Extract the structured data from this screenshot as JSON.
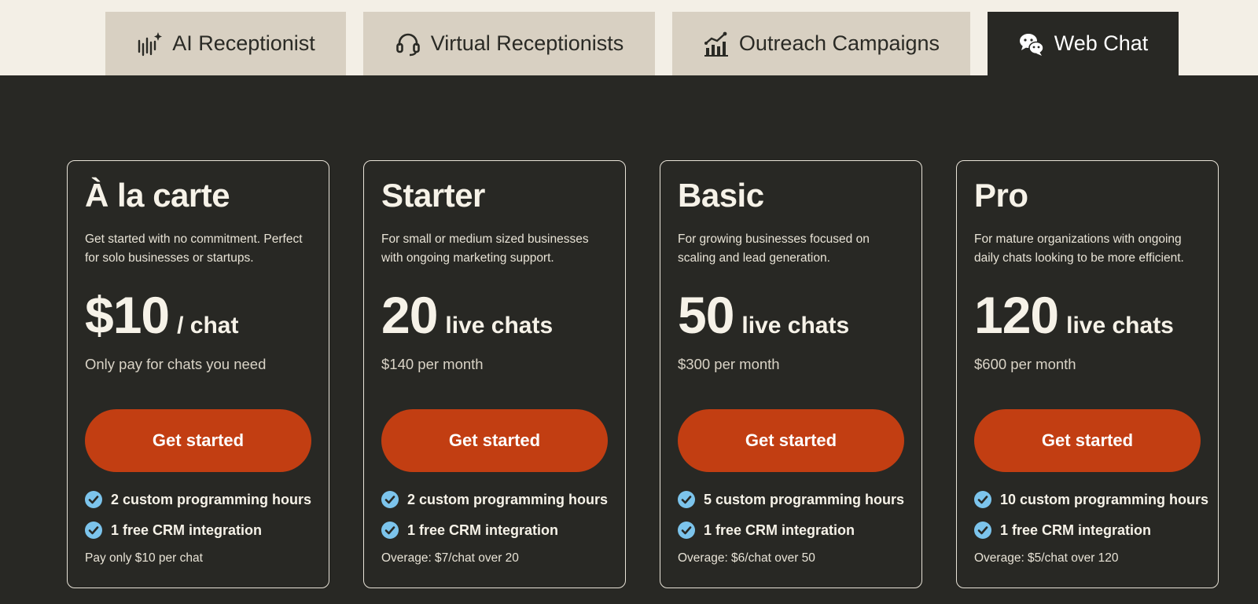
{
  "tabs": [
    {
      "label": "AI Receptionist",
      "icon": "voice-wave-sparkle-icon"
    },
    {
      "label": "Virtual Receptionists",
      "icon": "headset-icon"
    },
    {
      "label": "Outreach Campaigns",
      "icon": "bar-chart-trend-icon"
    },
    {
      "label": "Web Chat",
      "icon": "chat-bubbles-icon",
      "active": true
    }
  ],
  "plans": [
    {
      "title": "À la carte",
      "description": "Get started with no commitment. Perfect for solo businesses or startups.",
      "price_value": "$10",
      "price_unit": "/ chat",
      "price_sub": "Only pay for chats you need",
      "cta": "Get started",
      "features": [
        "2 custom programming hours",
        "1 free CRM integration"
      ],
      "note": "Pay only $10 per chat"
    },
    {
      "title": "Starter",
      "description": "For small or medium sized businesses with ongoing marketing support.",
      "price_value": "20",
      "price_unit": "live chats",
      "price_sub": "$140 per month",
      "cta": "Get started",
      "features": [
        "2 custom programming hours",
        "1 free CRM integration"
      ],
      "note": "Overage: $7/chat over 20"
    },
    {
      "title": "Basic",
      "description": "For growing businesses focused on scaling and lead generation.",
      "price_value": "50",
      "price_unit": "live chats",
      "price_sub": "$300 per month",
      "cta": "Get started",
      "features": [
        "5 custom programming hours",
        "1 free CRM integration"
      ],
      "note": "Overage: $6/chat over 50"
    },
    {
      "title": "Pro",
      "description": "For mature organizations with ongoing daily chats looking to be more efficient.",
      "price_value": "120",
      "price_unit": "live chats",
      "price_sub": "$600 per month",
      "cta": "Get started",
      "features": [
        "10 custom programming hours",
        "1 free CRM integration"
      ],
      "note": "Overage: $5/chat over 120"
    }
  ],
  "colors": {
    "page_bg": "#f3efe6",
    "tab_bg": "#d8d0c2",
    "panel_bg": "#282824",
    "cta_bg": "#c23e12",
    "check": "#7cc4ec"
  }
}
